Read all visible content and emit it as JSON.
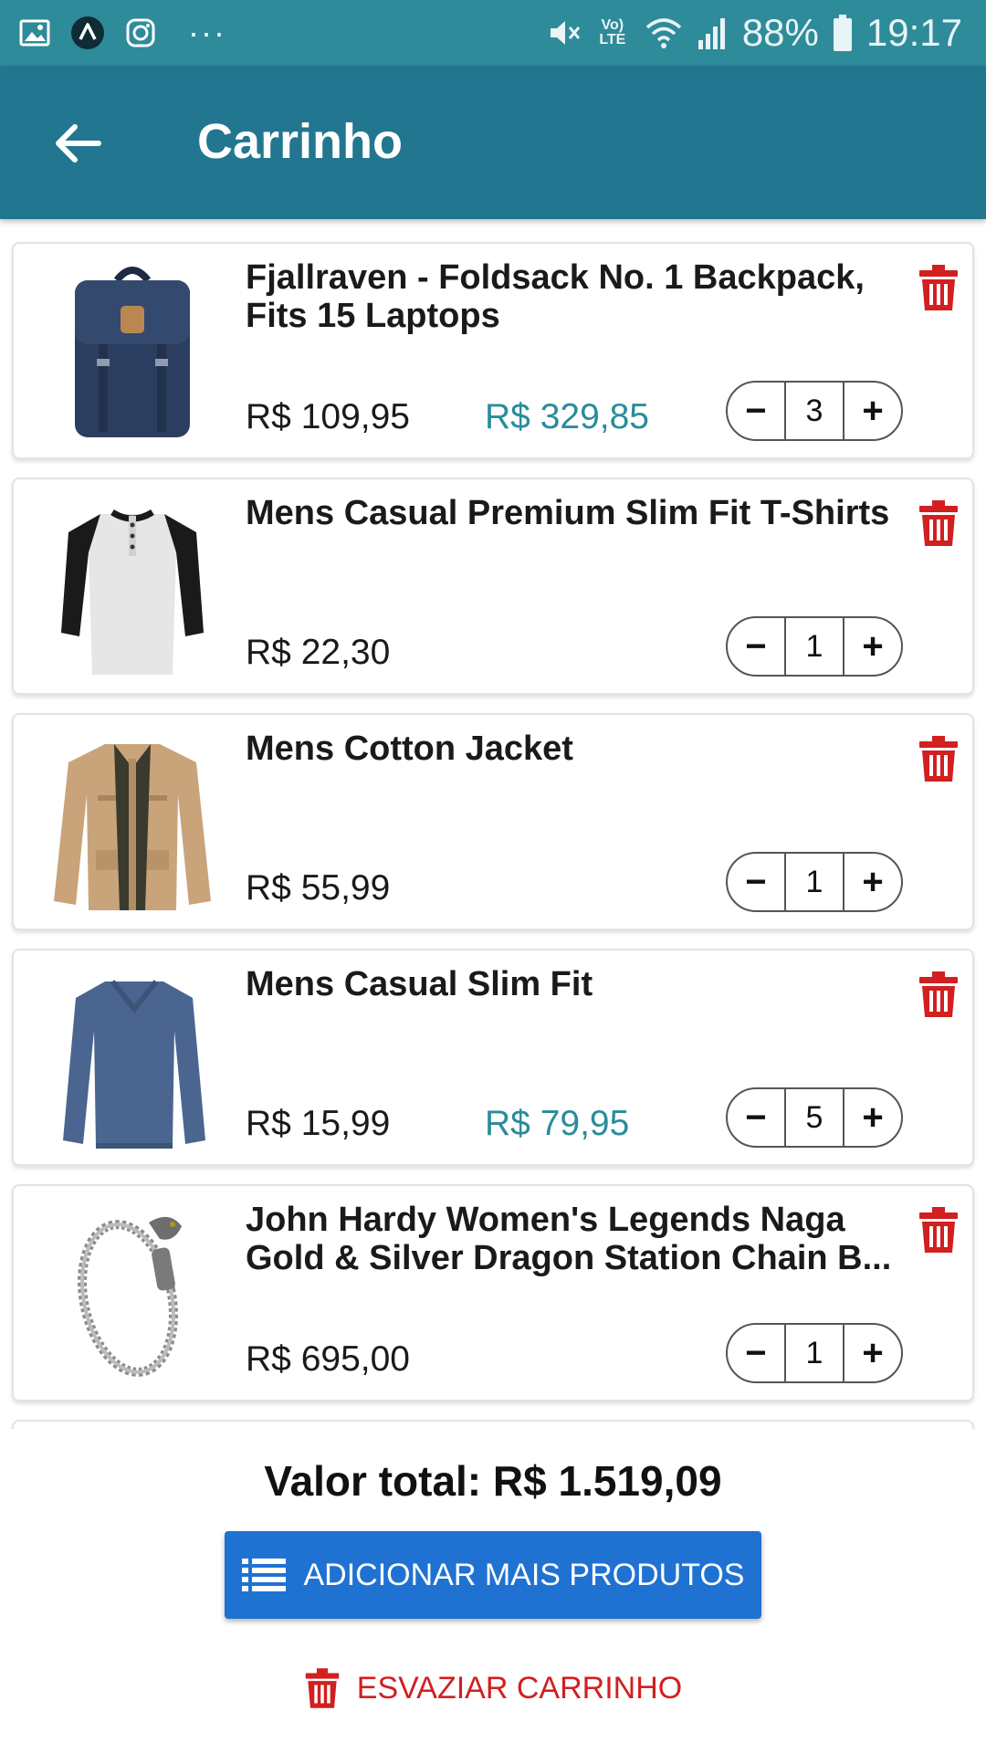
{
  "status_bar": {
    "battery": "88%",
    "time": "19:17",
    "more": "···",
    "network": "Vo) LTE"
  },
  "app_bar": {
    "title": "Carrinho"
  },
  "colors": {
    "status_bar": "#2e8b9a",
    "app_bar": "#22768f",
    "accent_price": "#2a8c9a",
    "primary_button": "#1f72d2",
    "danger": "#d21f1f"
  },
  "cart": {
    "items": [
      {
        "name": "Fjallraven - Foldsack No. 1 Backpack, Fits 15 Laptops",
        "unit_price": "R$ 109,95",
        "total_price": "R$ 329,85",
        "quantity": "3",
        "image": "backpack-image"
      },
      {
        "name": "Mens Casual Premium Slim Fit T-Shirts",
        "unit_price": "R$ 22,30",
        "total_price": "",
        "quantity": "1",
        "image": "tshirt-image"
      },
      {
        "name": "Mens Cotton Jacket",
        "unit_price": "R$ 55,99",
        "total_price": "",
        "quantity": "1",
        "image": "jacket-image"
      },
      {
        "name": "Mens Casual Slim Fit",
        "unit_price": "R$ 15,99",
        "total_price": "R$ 79,95",
        "quantity": "5",
        "image": "longsleeve-image"
      },
      {
        "name": "John Hardy Women's Legends Naga Gold & Silver Dragon Station Chain B...",
        "unit_price": "R$ 695,00",
        "total_price": "",
        "quantity": "1",
        "image": "bracelet-image"
      }
    ],
    "minus_symbol": "−",
    "plus_symbol": "+"
  },
  "footer": {
    "total_label": "Valor total: R$ 1.519,09",
    "add_button": "ADICIONAR MAIS PRODUTOS",
    "empty_button": "ESVAZIAR CARRINHO"
  }
}
